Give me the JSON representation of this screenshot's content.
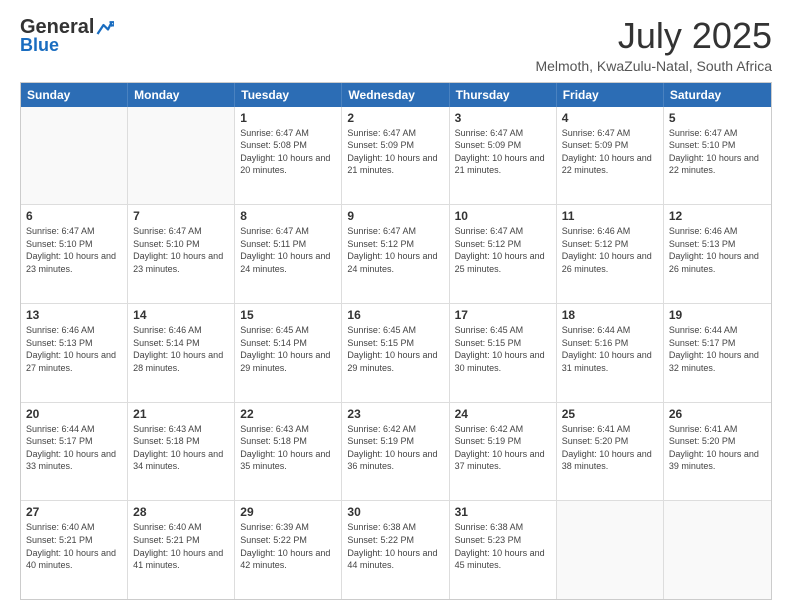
{
  "logo": {
    "general": "General",
    "blue": "Blue"
  },
  "header": {
    "month": "July 2025",
    "location": "Melmoth, KwaZulu-Natal, South Africa"
  },
  "days_of_week": [
    "Sunday",
    "Monday",
    "Tuesday",
    "Wednesday",
    "Thursday",
    "Friday",
    "Saturday"
  ],
  "weeks": [
    [
      {
        "day": "",
        "sunrise": "",
        "sunset": "",
        "daylight": "",
        "empty": true
      },
      {
        "day": "",
        "sunrise": "",
        "sunset": "",
        "daylight": "",
        "empty": true
      },
      {
        "day": "1",
        "sunrise": "Sunrise: 6:47 AM",
        "sunset": "Sunset: 5:08 PM",
        "daylight": "Daylight: 10 hours and 20 minutes.",
        "empty": false
      },
      {
        "day": "2",
        "sunrise": "Sunrise: 6:47 AM",
        "sunset": "Sunset: 5:09 PM",
        "daylight": "Daylight: 10 hours and 21 minutes.",
        "empty": false
      },
      {
        "day": "3",
        "sunrise": "Sunrise: 6:47 AM",
        "sunset": "Sunset: 5:09 PM",
        "daylight": "Daylight: 10 hours and 21 minutes.",
        "empty": false
      },
      {
        "day": "4",
        "sunrise": "Sunrise: 6:47 AM",
        "sunset": "Sunset: 5:09 PM",
        "daylight": "Daylight: 10 hours and 22 minutes.",
        "empty": false
      },
      {
        "day": "5",
        "sunrise": "Sunrise: 6:47 AM",
        "sunset": "Sunset: 5:10 PM",
        "daylight": "Daylight: 10 hours and 22 minutes.",
        "empty": false
      }
    ],
    [
      {
        "day": "6",
        "sunrise": "Sunrise: 6:47 AM",
        "sunset": "Sunset: 5:10 PM",
        "daylight": "Daylight: 10 hours and 23 minutes.",
        "empty": false
      },
      {
        "day": "7",
        "sunrise": "Sunrise: 6:47 AM",
        "sunset": "Sunset: 5:10 PM",
        "daylight": "Daylight: 10 hours and 23 minutes.",
        "empty": false
      },
      {
        "day": "8",
        "sunrise": "Sunrise: 6:47 AM",
        "sunset": "Sunset: 5:11 PM",
        "daylight": "Daylight: 10 hours and 24 minutes.",
        "empty": false
      },
      {
        "day": "9",
        "sunrise": "Sunrise: 6:47 AM",
        "sunset": "Sunset: 5:12 PM",
        "daylight": "Daylight: 10 hours and 24 minutes.",
        "empty": false
      },
      {
        "day": "10",
        "sunrise": "Sunrise: 6:47 AM",
        "sunset": "Sunset: 5:12 PM",
        "daylight": "Daylight: 10 hours and 25 minutes.",
        "empty": false
      },
      {
        "day": "11",
        "sunrise": "Sunrise: 6:46 AM",
        "sunset": "Sunset: 5:12 PM",
        "daylight": "Daylight: 10 hours and 26 minutes.",
        "empty": false
      },
      {
        "day": "12",
        "sunrise": "Sunrise: 6:46 AM",
        "sunset": "Sunset: 5:13 PM",
        "daylight": "Daylight: 10 hours and 26 minutes.",
        "empty": false
      }
    ],
    [
      {
        "day": "13",
        "sunrise": "Sunrise: 6:46 AM",
        "sunset": "Sunset: 5:13 PM",
        "daylight": "Daylight: 10 hours and 27 minutes.",
        "empty": false
      },
      {
        "day": "14",
        "sunrise": "Sunrise: 6:46 AM",
        "sunset": "Sunset: 5:14 PM",
        "daylight": "Daylight: 10 hours and 28 minutes.",
        "empty": false
      },
      {
        "day": "15",
        "sunrise": "Sunrise: 6:45 AM",
        "sunset": "Sunset: 5:14 PM",
        "daylight": "Daylight: 10 hours and 29 minutes.",
        "empty": false
      },
      {
        "day": "16",
        "sunrise": "Sunrise: 6:45 AM",
        "sunset": "Sunset: 5:15 PM",
        "daylight": "Daylight: 10 hours and 29 minutes.",
        "empty": false
      },
      {
        "day": "17",
        "sunrise": "Sunrise: 6:45 AM",
        "sunset": "Sunset: 5:15 PM",
        "daylight": "Daylight: 10 hours and 30 minutes.",
        "empty": false
      },
      {
        "day": "18",
        "sunrise": "Sunrise: 6:44 AM",
        "sunset": "Sunset: 5:16 PM",
        "daylight": "Daylight: 10 hours and 31 minutes.",
        "empty": false
      },
      {
        "day": "19",
        "sunrise": "Sunrise: 6:44 AM",
        "sunset": "Sunset: 5:17 PM",
        "daylight": "Daylight: 10 hours and 32 minutes.",
        "empty": false
      }
    ],
    [
      {
        "day": "20",
        "sunrise": "Sunrise: 6:44 AM",
        "sunset": "Sunset: 5:17 PM",
        "daylight": "Daylight: 10 hours and 33 minutes.",
        "empty": false
      },
      {
        "day": "21",
        "sunrise": "Sunrise: 6:43 AM",
        "sunset": "Sunset: 5:18 PM",
        "daylight": "Daylight: 10 hours and 34 minutes.",
        "empty": false
      },
      {
        "day": "22",
        "sunrise": "Sunrise: 6:43 AM",
        "sunset": "Sunset: 5:18 PM",
        "daylight": "Daylight: 10 hours and 35 minutes.",
        "empty": false
      },
      {
        "day": "23",
        "sunrise": "Sunrise: 6:42 AM",
        "sunset": "Sunset: 5:19 PM",
        "daylight": "Daylight: 10 hours and 36 minutes.",
        "empty": false
      },
      {
        "day": "24",
        "sunrise": "Sunrise: 6:42 AM",
        "sunset": "Sunset: 5:19 PM",
        "daylight": "Daylight: 10 hours and 37 minutes.",
        "empty": false
      },
      {
        "day": "25",
        "sunrise": "Sunrise: 6:41 AM",
        "sunset": "Sunset: 5:20 PM",
        "daylight": "Daylight: 10 hours and 38 minutes.",
        "empty": false
      },
      {
        "day": "26",
        "sunrise": "Sunrise: 6:41 AM",
        "sunset": "Sunset: 5:20 PM",
        "daylight": "Daylight: 10 hours and 39 minutes.",
        "empty": false
      }
    ],
    [
      {
        "day": "27",
        "sunrise": "Sunrise: 6:40 AM",
        "sunset": "Sunset: 5:21 PM",
        "daylight": "Daylight: 10 hours and 40 minutes.",
        "empty": false
      },
      {
        "day": "28",
        "sunrise": "Sunrise: 6:40 AM",
        "sunset": "Sunset: 5:21 PM",
        "daylight": "Daylight: 10 hours and 41 minutes.",
        "empty": false
      },
      {
        "day": "29",
        "sunrise": "Sunrise: 6:39 AM",
        "sunset": "Sunset: 5:22 PM",
        "daylight": "Daylight: 10 hours and 42 minutes.",
        "empty": false
      },
      {
        "day": "30",
        "sunrise": "Sunrise: 6:38 AM",
        "sunset": "Sunset: 5:22 PM",
        "daylight": "Daylight: 10 hours and 44 minutes.",
        "empty": false
      },
      {
        "day": "31",
        "sunrise": "Sunrise: 6:38 AM",
        "sunset": "Sunset: 5:23 PM",
        "daylight": "Daylight: 10 hours and 45 minutes.",
        "empty": false
      },
      {
        "day": "",
        "sunrise": "",
        "sunset": "",
        "daylight": "",
        "empty": true
      },
      {
        "day": "",
        "sunrise": "",
        "sunset": "",
        "daylight": "",
        "empty": true
      }
    ]
  ]
}
